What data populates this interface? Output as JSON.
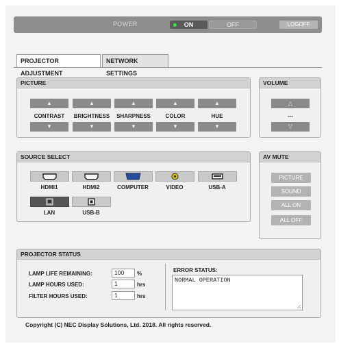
{
  "power": {
    "label": "POWER",
    "on": "ON",
    "off": "OFF",
    "logoff": "LOGOFF"
  },
  "tabs": [
    {
      "label": "PROJECTOR ADJUSTMENT"
    },
    {
      "label": "NETWORK SETTINGS"
    }
  ],
  "picture": {
    "title": "PICTURE",
    "controls": [
      {
        "label": "CONTRAST"
      },
      {
        "label": "BRIGHTNESS"
      },
      {
        "label": "SHARPNESS"
      },
      {
        "label": "COLOR"
      },
      {
        "label": "HUE"
      }
    ],
    "up_glyph": "▲",
    "down_glyph": "▼"
  },
  "volume": {
    "title": "VOLUME",
    "value": "---",
    "up_glyph": "△",
    "down_glyph": "▽"
  },
  "source": {
    "title": "SOURCE SELECT",
    "items": [
      {
        "label": "HDMI1",
        "icon": "hdmi-port-icon"
      },
      {
        "label": "HDMI2",
        "icon": "hdmi-port-icon"
      },
      {
        "label": "COMPUTER",
        "icon": "vga-port-icon"
      },
      {
        "label": "VIDEO",
        "icon": "rca-port-icon"
      },
      {
        "label": "USB-A",
        "icon": "usb-a-port-icon"
      },
      {
        "label": "LAN",
        "icon": "lan-port-icon",
        "selected": true
      },
      {
        "label": "USB-B",
        "icon": "usb-b-port-icon"
      }
    ]
  },
  "av_mute": {
    "title": "AV MUTE",
    "buttons": [
      "PICTURE",
      "SOUND",
      "ALL ON",
      "ALL OFF"
    ]
  },
  "status": {
    "title": "PROJECTOR STATUS",
    "lamp_life_label": "LAMP LIFE REMAINING:",
    "lamp_life_value": "100",
    "lamp_life_unit": "%",
    "lamp_hours_label": "LAMP HOURS USED:",
    "lamp_hours_value": "1",
    "lamp_hours_unit": "hrs",
    "filter_hours_label": "FILTER HOURS USED:",
    "filter_hours_value": "1",
    "filter_hours_unit": "hrs",
    "error_label": "ERROR STATUS:",
    "error_value": "NORMAL OPERATION"
  },
  "footer": "Copyright (C) NEC Display Solutions, Ltd. 2018. All rights reserved.",
  "colors": {
    "power_led": "#3ee43e",
    "video_led": "#d4c400",
    "vga_blue": "#2a4d9b"
  }
}
